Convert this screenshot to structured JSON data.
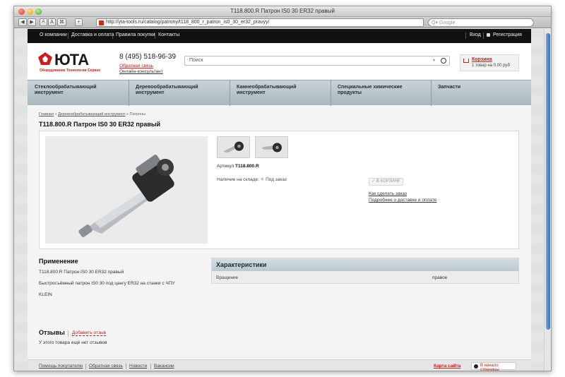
{
  "browser": {
    "window_title": "T118.800.R Патрон IS0 30 ER32 правый",
    "url": "http://yta-tools.ru/catalog/patrony/t118_800_r_patron_is0_30_er32_pravyy/",
    "search_placeholder": "Q▾ Google",
    "buttons": {
      "back": "◀",
      "forward": "▶",
      "font_small": "A",
      "font_large": "A",
      "bookmark": "⌘",
      "add": "+"
    }
  },
  "topnav": {
    "items": [
      "О компании",
      "Доставка и оплата",
      "Правила покупки",
      "Контакты"
    ],
    "login": "Вход",
    "register": "Регистрация"
  },
  "header": {
    "logo": "ЮТА",
    "logo_sub": "Оборудование Технологии Сервис",
    "phone": "8 (495) 518-96-39",
    "callback": "Обратная связь",
    "consultant": "Онлайн-консультант",
    "search_placeholder": "Поиск",
    "search_dropdown": "▾",
    "cart_title": "Корзина",
    "cart_summary": "1 товар на 0.00 руб"
  },
  "categories": [
    "Стеклообрабатывающий инструмент",
    "Деревообрабатывающий инструмент",
    "Камнеобрабатывающий инструмент",
    "Специальные химические продукты",
    "Запчасти"
  ],
  "breadcrumbs": {
    "home": "Главная",
    "section": "Деревообрабатывающий инструмент",
    "current": "Патроны",
    "sep": "»"
  },
  "product": {
    "title": "T118.800.R Патрон IS0 30 ER32 правый",
    "sku_label": "Артикул",
    "sku": "T118.800.R",
    "stock_label": "Наличие на складе:",
    "stock_value": "Под заказ",
    "stock_icon": "✕",
    "cart_button": "В КОРЗИНЕ",
    "cart_check": "✓",
    "how_to_order": "Как сделать заказ",
    "delivery_info": "Подробнее о доставке и оплате"
  },
  "application": {
    "title": "Применение",
    "lines": [
      "T118.800.R Патрон IS0 30 ER32 правый",
      "Быстросъёмный патрон IS0 30 под цангу ER32 на станки с ЧПУ",
      "KLEIN"
    ]
  },
  "characteristics": {
    "title": "Характеристики",
    "rows": [
      {
        "key": "Вращение",
        "value": "правое"
      }
    ]
  },
  "reviews": {
    "title": "Отзывы",
    "add": "Добавить отзыв",
    "empty": "У этого товара ещё нет отзывов"
  },
  "footer": {
    "links": [
      "Помощь покупателю",
      "Обратная связь",
      "Новости",
      "Вакансии"
    ],
    "site_map": "Карта сайта",
    "to_top": "В начало страницы"
  },
  "colors": {
    "brand_red": "#c4221a",
    "nav_dark": "#111111",
    "category_bar": "#b3c0c8"
  }
}
